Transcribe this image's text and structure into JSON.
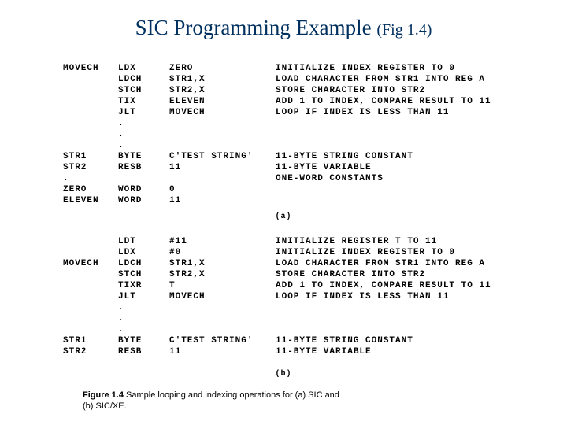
{
  "title_main": "SIC Programming Example ",
  "title_fig": "(Fig 1.4)",
  "part_a_label": "(a)",
  "part_b_label": "(b)",
  "caption_figlabel": "Figure 1.4",
  "caption_text": "   Sample looping and indexing operations for (a) SIC and",
  "caption_text2": "(b) SIC/XE.",
  "code_a": [
    {
      "label": "MOVECH",
      "op": "LDX",
      "arg": "ZERO",
      "cmt": "INITIALIZE INDEX REGISTER TO 0"
    },
    {
      "label": "",
      "op": "LDCH",
      "arg": "STR1,X",
      "cmt": "LOAD CHARACTER FROM STR1 INTO REG A"
    },
    {
      "label": "",
      "op": "STCH",
      "arg": "STR2,X",
      "cmt": "STORE CHARACTER INTO STR2"
    },
    {
      "label": "",
      "op": "TIX",
      "arg": "ELEVEN",
      "cmt": "ADD 1 TO INDEX, COMPARE RESULT TO 11"
    },
    {
      "label": "",
      "op": "JLT",
      "arg": "MOVECH",
      "cmt": "LOOP IF INDEX IS LESS THAN 11"
    },
    {
      "label": "",
      "op": ".",
      "arg": "",
      "cmt": ""
    },
    {
      "label": "",
      "op": ".",
      "arg": "",
      "cmt": ""
    },
    {
      "label": "",
      "op": ".",
      "arg": "",
      "cmt": ""
    },
    {
      "label": "STR1",
      "op": "BYTE",
      "arg": "C'TEST STRING'",
      "cmt": "11-BYTE STRING CONSTANT"
    },
    {
      "label": "STR2",
      "op": "RESB",
      "arg": "11",
      "cmt": "11-BYTE VARIABLE"
    },
    {
      "label": ".",
      "op": "",
      "arg": "",
      "cmt": "ONE-WORD CONSTANTS"
    },
    {
      "label": "ZERO",
      "op": "WORD",
      "arg": "0",
      "cmt": ""
    },
    {
      "label": "ELEVEN",
      "op": "WORD",
      "arg": "11",
      "cmt": ""
    }
  ],
  "code_b": [
    {
      "label": "",
      "op": "LDT",
      "arg": "#11",
      "cmt": "INITIALIZE REGISTER T TO 11"
    },
    {
      "label": "",
      "op": "LDX",
      "arg": "#0",
      "cmt": "INITIALIZE INDEX REGISTER TO 0"
    },
    {
      "label": "MOVECH",
      "op": "LDCH",
      "arg": "STR1,X",
      "cmt": "LOAD CHARACTER FROM STR1 INTO REG A"
    },
    {
      "label": "",
      "op": "STCH",
      "arg": "STR2,X",
      "cmt": "STORE CHARACTER INTO STR2"
    },
    {
      "label": "",
      "op": "TIXR",
      "arg": "T",
      "cmt": "ADD 1 TO INDEX, COMPARE RESULT TO 11"
    },
    {
      "label": "",
      "op": "JLT",
      "arg": "MOVECH",
      "cmt": "LOOP IF INDEX IS LESS THAN 11"
    },
    {
      "label": "",
      "op": ".",
      "arg": "",
      "cmt": ""
    },
    {
      "label": "",
      "op": ".",
      "arg": "",
      "cmt": ""
    },
    {
      "label": "",
      "op": ".",
      "arg": "",
      "cmt": ""
    },
    {
      "label": "STR1",
      "op": "BYTE",
      "arg": "C'TEST STRING'",
      "cmt": "11-BYTE STRING CONSTANT"
    },
    {
      "label": "STR2",
      "op": "RESB",
      "arg": "11",
      "cmt": "11-BYTE VARIABLE"
    }
  ]
}
